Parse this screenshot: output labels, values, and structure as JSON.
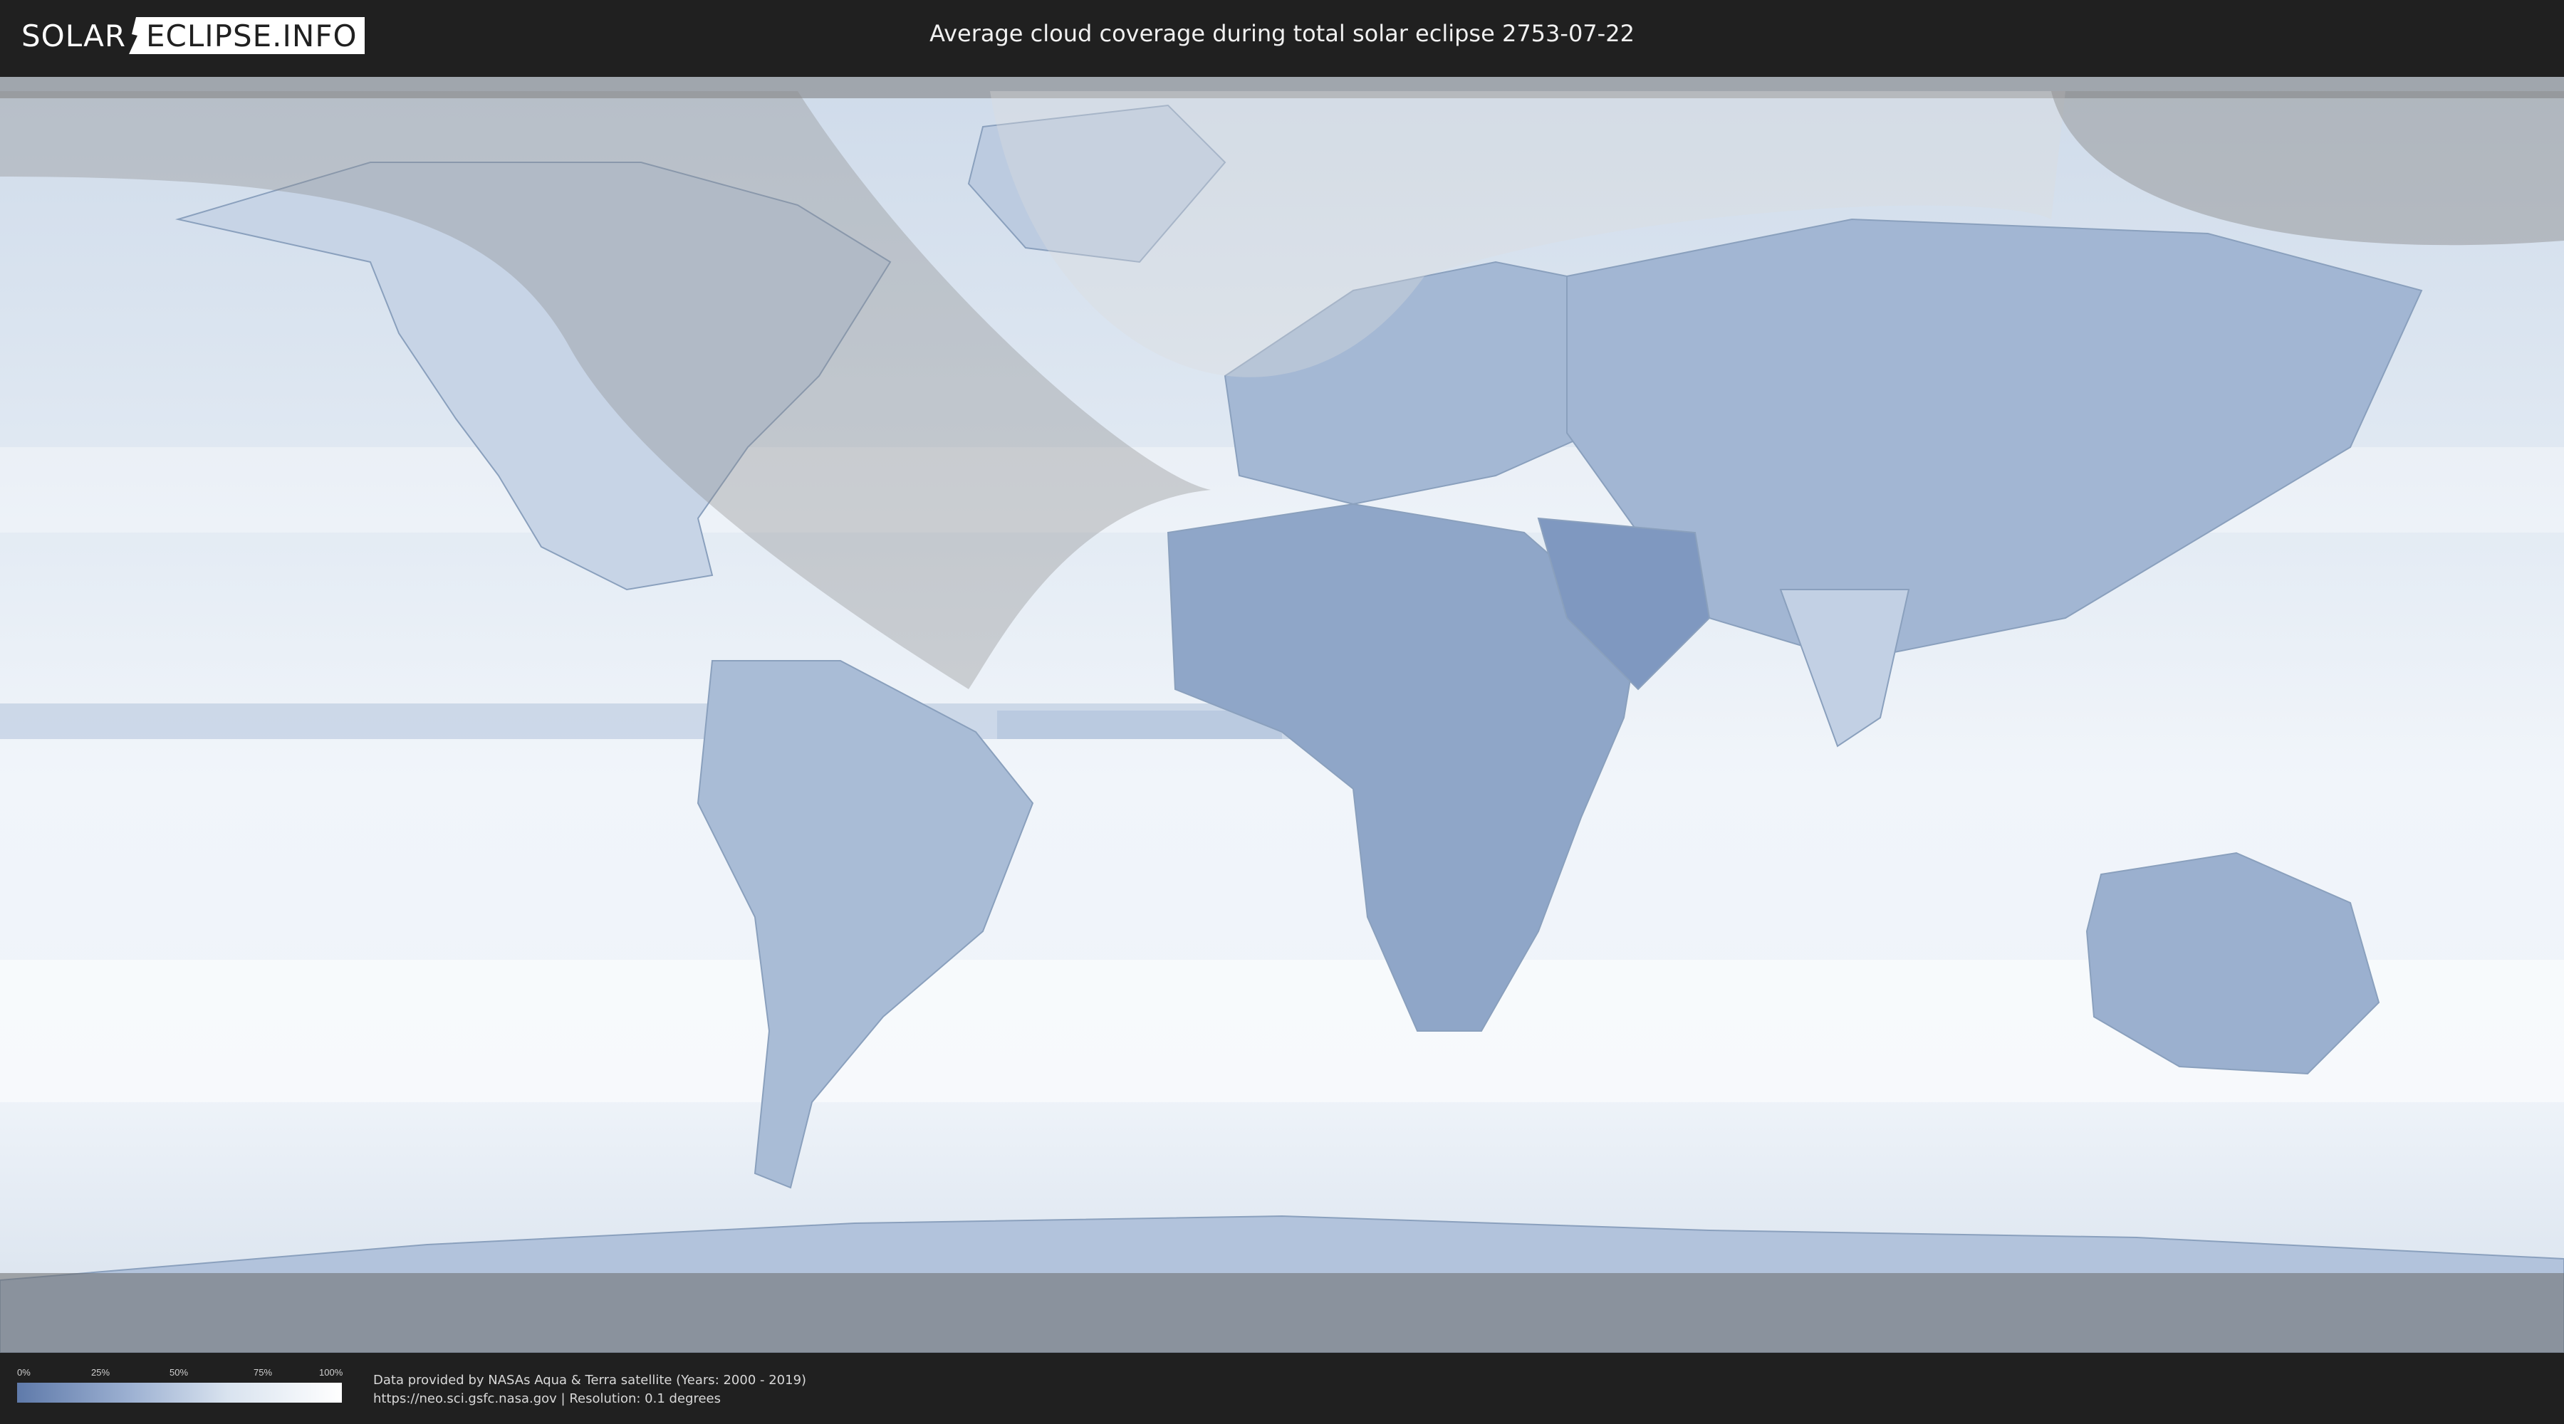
{
  "header": {
    "logo_left": "SOLAR",
    "logo_right": "ECLIPSE.INFO",
    "title": "Average cloud coverage during total solar eclipse 2753-07-22"
  },
  "legend": {
    "ticks": [
      "0%",
      "25%",
      "50%",
      "75%",
      "100%"
    ],
    "colors": {
      "low": "#5f7aaa",
      "mid": "#d9e3ef",
      "high": "#ffffff"
    }
  },
  "credits": {
    "line1": "Data provided by NASAs Aqua & Terra satellite (Years: 2000 - 2019)",
    "line2": "https://neo.sci.gsfc.nasa.gov | Resolution: 0.1 degrees"
  }
}
